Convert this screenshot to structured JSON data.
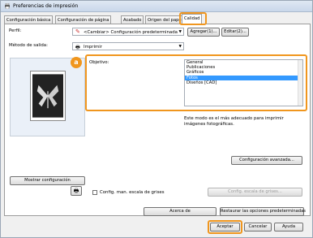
{
  "window": {
    "title": "Preferencias de impresión"
  },
  "tabs": [
    {
      "label": "Configuración básica"
    },
    {
      "label": "Configuración de página"
    },
    {
      "label": "Acabado"
    },
    {
      "label": "Origen del pape"
    },
    {
      "label": "Calidad"
    }
  ],
  "profile": {
    "label": "Perfil:",
    "value": "<Cambiar> Configuración predeterminada",
    "add_button": "Agregar(1)...",
    "edit_button": "Editar(2)..."
  },
  "output_method": {
    "label": "Método de salida:",
    "value": "Imprimir"
  },
  "objective": {
    "label": "Objetivo:",
    "items": [
      "General",
      "Publicaciones",
      "Gráficos",
      "Fotos",
      "Diseños [CAD]"
    ],
    "selected": "Fotos",
    "description": "Este modo es el más adecuado para imprimir imágenes fotográficas."
  },
  "badge": {
    "text": "a",
    "color": "#f0961e"
  },
  "buttons": {
    "advanced": "Configuración avanzada...",
    "show_config": "Mostrar configuración",
    "grayscale_config": "Config. escala de grises...",
    "about": "Acerca de",
    "restore": "Restaurar las opciones predeterminadas",
    "accept": "Aceptar",
    "cancel": "Cancelar",
    "help": "Ayuda"
  },
  "grayscale_checkbox": {
    "label": "Config. man. escala de grises",
    "checked": false
  }
}
